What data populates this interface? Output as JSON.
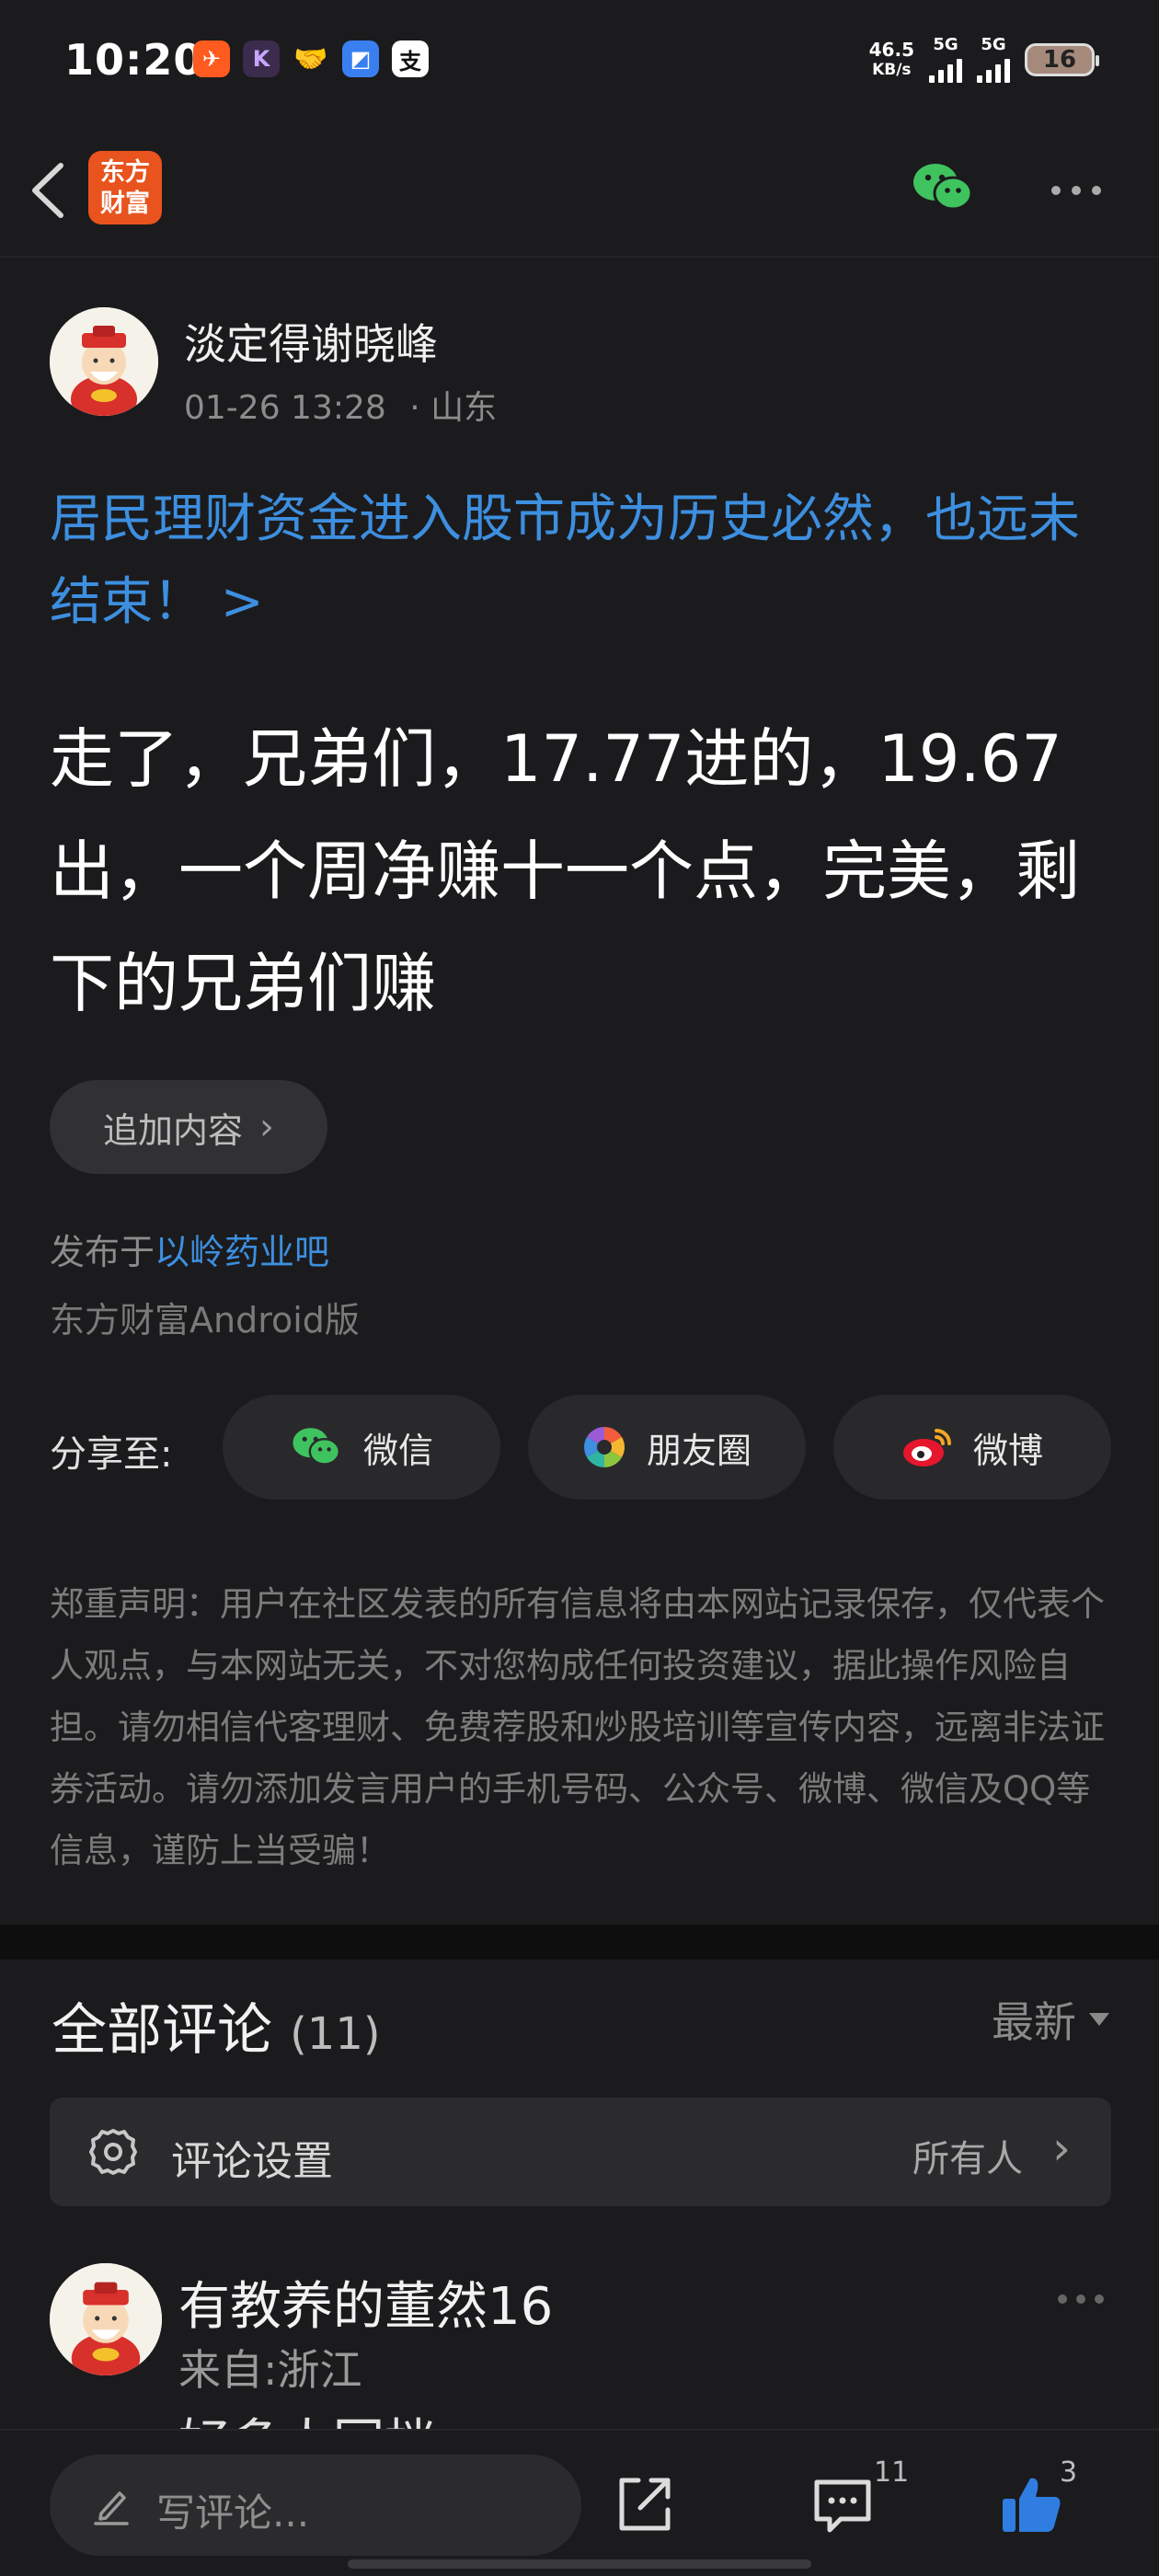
{
  "status_bar": {
    "time": "10:20",
    "net_speed_value": "46.5",
    "net_speed_unit": "KB/s",
    "sim1": "5G",
    "sim2": "5G",
    "battery": "16",
    "app_icons": [
      "fliggy-icon",
      "k-app-icon",
      "handshake-icon",
      "blue-app-icon",
      "alipay-icon"
    ]
  },
  "header": {
    "logo_line1": "东方",
    "logo_line2": "财富"
  },
  "post": {
    "author_name": "淡定得谢晓峰",
    "timestamp": "01-26 13:28",
    "location": "· 山东",
    "topic_link": "居民理财资金进入股市成为历史必然，也远未结束！ >",
    "body": "走了，兄弟们，17.77进的，19.67出，一个周净赚十一个点，完美，剩下的兄弟们赚",
    "append_button": "追加内容",
    "published_prefix": "发布于",
    "published_bar": "以岭药业吧",
    "client": "东方财富Android版"
  },
  "share": {
    "label": "分享至:",
    "wechat": "微信",
    "moments": "朋友圈",
    "weibo": "微博"
  },
  "disclaimer": "郑重声明：用户在社区发表的所有信息将由本网站记录保存，仅代表个人观点，与本网站无关，不对您构成任何投资建议，据此操作风险自担。请勿相信代客理财、免费荐股和炒股培训等宣传内容，远离非法证券活动。请勿添加发言用户的手机号码、公众号、微博、微信及QQ等信息，谨防上当受骗！",
  "comments": {
    "title": "全部评论",
    "count": "(11)",
    "sort": "最新",
    "settings_label": "评论设置",
    "settings_value": "所有人",
    "first": {
      "name": "有教养的董然16",
      "from": "来自:浙江",
      "text_peek": "好多人回档"
    }
  },
  "bottom_bar": {
    "write_placeholder": "写评论...",
    "comment_count": "11",
    "like_count": "3"
  },
  "colors": {
    "background": "#1b1b1d",
    "accent_link": "#3d8fe0",
    "brand_orange": "#e8531e",
    "like_blue": "#2f7de1"
  }
}
